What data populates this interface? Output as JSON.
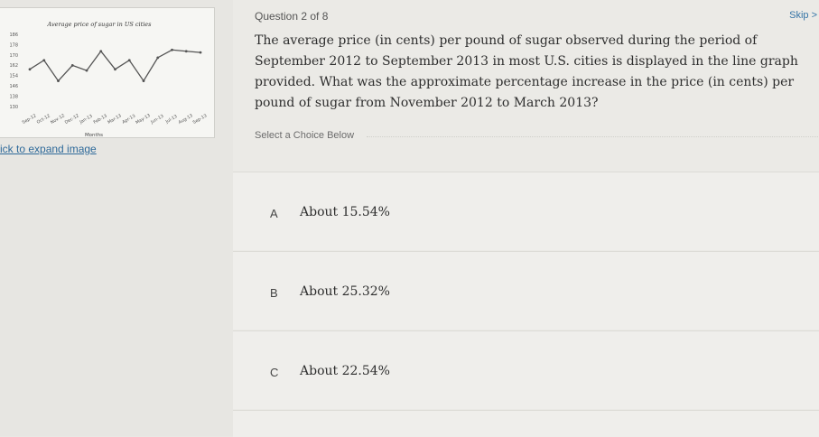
{
  "chart": {
    "title": "Average price of sugar in US cities",
    "xlabel": "Months"
  },
  "chart_data": {
    "type": "line",
    "title": "Average price of sugar in US cities",
    "xlabel": "Months",
    "ylabel": "",
    "categories": [
      "Sep-12",
      "Oct-12",
      "Nov-12",
      "Dec-12",
      "Jan-13",
      "Feb-13",
      "Mar-13",
      "Apr-13",
      "May-13",
      "Jun-13",
      "Jul-13",
      "Aug-13",
      "Sep-13"
    ],
    "series": [
      {
        "values": [
          161,
          168,
          152,
          164,
          160,
          175,
          161,
          168,
          152,
          170,
          176,
          175,
          174
        ]
      }
    ],
    "y_ticks": [
      "186",
      "178",
      "170",
      "162",
      "154",
      "146",
      "138",
      "130"
    ],
    "ylim": [
      130,
      186
    ],
    "line_color": "#555555"
  },
  "expand_link": "ick to expand image",
  "question_number": "Question 2 of 8",
  "skip_label": "Skip >",
  "question_text": "The average price (in cents) per pound of sugar observed during the period of September 2012 to September 2013 in most U.S. cities is displayed in the line graph provided. What was the approximate percentage increase in the price (in cents) per pound of sugar from November 2012 to March 2013?",
  "prompt": "Select a Choice Below",
  "choices": [
    {
      "letter": "A",
      "text": "About 15.54%"
    },
    {
      "letter": "B",
      "text": "About 25.32%"
    },
    {
      "letter": "C",
      "text": "About 22.54%"
    }
  ]
}
